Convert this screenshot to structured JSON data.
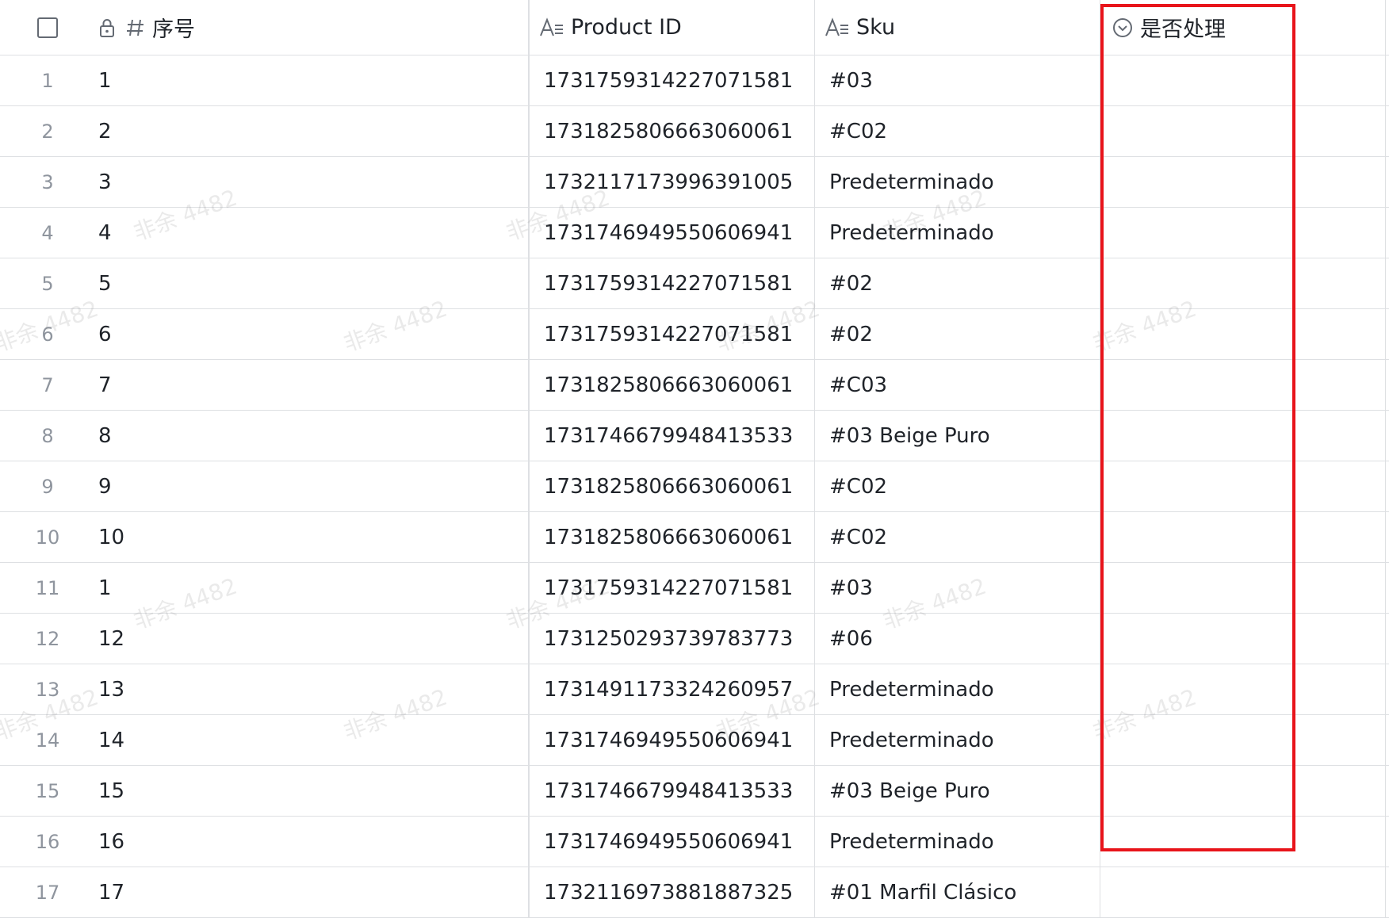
{
  "columns": {
    "sequence": "序号",
    "product_id": "Product ID",
    "sku": "Sku",
    "processed": "是否处理"
  },
  "rows": [
    {
      "index": "1",
      "sequence": "1",
      "product_id": "1731759314227071581",
      "sku": "#03",
      "processed": ""
    },
    {
      "index": "2",
      "sequence": "2",
      "product_id": "1731825806663060061",
      "sku": "#C02",
      "processed": ""
    },
    {
      "index": "3",
      "sequence": "3",
      "product_id": "1732117173996391005",
      "sku": "Predeterminado",
      "processed": ""
    },
    {
      "index": "4",
      "sequence": "4",
      "product_id": "1731746949550606941",
      "sku": "Predeterminado",
      "processed": ""
    },
    {
      "index": "5",
      "sequence": "5",
      "product_id": "1731759314227071581",
      "sku": "#02",
      "processed": ""
    },
    {
      "index": "6",
      "sequence": "6",
      "product_id": "1731759314227071581",
      "sku": "#02",
      "processed": ""
    },
    {
      "index": "7",
      "sequence": "7",
      "product_id": "1731825806663060061",
      "sku": "#C03",
      "processed": ""
    },
    {
      "index": "8",
      "sequence": "8",
      "product_id": "1731746679948413533",
      "sku": "#03 Beige Puro",
      "processed": ""
    },
    {
      "index": "9",
      "sequence": "9",
      "product_id": "1731825806663060061",
      "sku": "#C02",
      "processed": ""
    },
    {
      "index": "10",
      "sequence": "10",
      "product_id": "1731825806663060061",
      "sku": "#C02",
      "processed": ""
    },
    {
      "index": "11",
      "sequence": "1",
      "product_id": "1731759314227071581",
      "sku": "#03",
      "processed": ""
    },
    {
      "index": "12",
      "sequence": "12",
      "product_id": "1731250293739783773",
      "sku": "#06",
      "processed": ""
    },
    {
      "index": "13",
      "sequence": "13",
      "product_id": "1731491173324260957",
      "sku": "Predeterminado",
      "processed": ""
    },
    {
      "index": "14",
      "sequence": "14",
      "product_id": "1731746949550606941",
      "sku": "Predeterminado",
      "processed": ""
    },
    {
      "index": "15",
      "sequence": "15",
      "product_id": "1731746679948413533",
      "sku": "#03 Beige Puro",
      "processed": ""
    },
    {
      "index": "16",
      "sequence": "16",
      "product_id": "1731746949550606941",
      "sku": "Predeterminado",
      "processed": ""
    },
    {
      "index": "17",
      "sequence": "17",
      "product_id": "1732116973881887325",
      "sku": "#01 Marfil Clásico",
      "processed": ""
    }
  ],
  "watermark": "非余 4482",
  "icons": {
    "header_checkbox": "checkbox-icon",
    "sequence_lock": "lock-icon",
    "sequence_type": "number-hash-icon",
    "product_id_type": "text-field-icon",
    "sku_type": "text-field-icon",
    "processed_type": "single-select-icon"
  },
  "colors": {
    "highlight": "#e8141b",
    "border": "#dee0e3",
    "text": "#1f2329",
    "muted": "#8f959e"
  }
}
